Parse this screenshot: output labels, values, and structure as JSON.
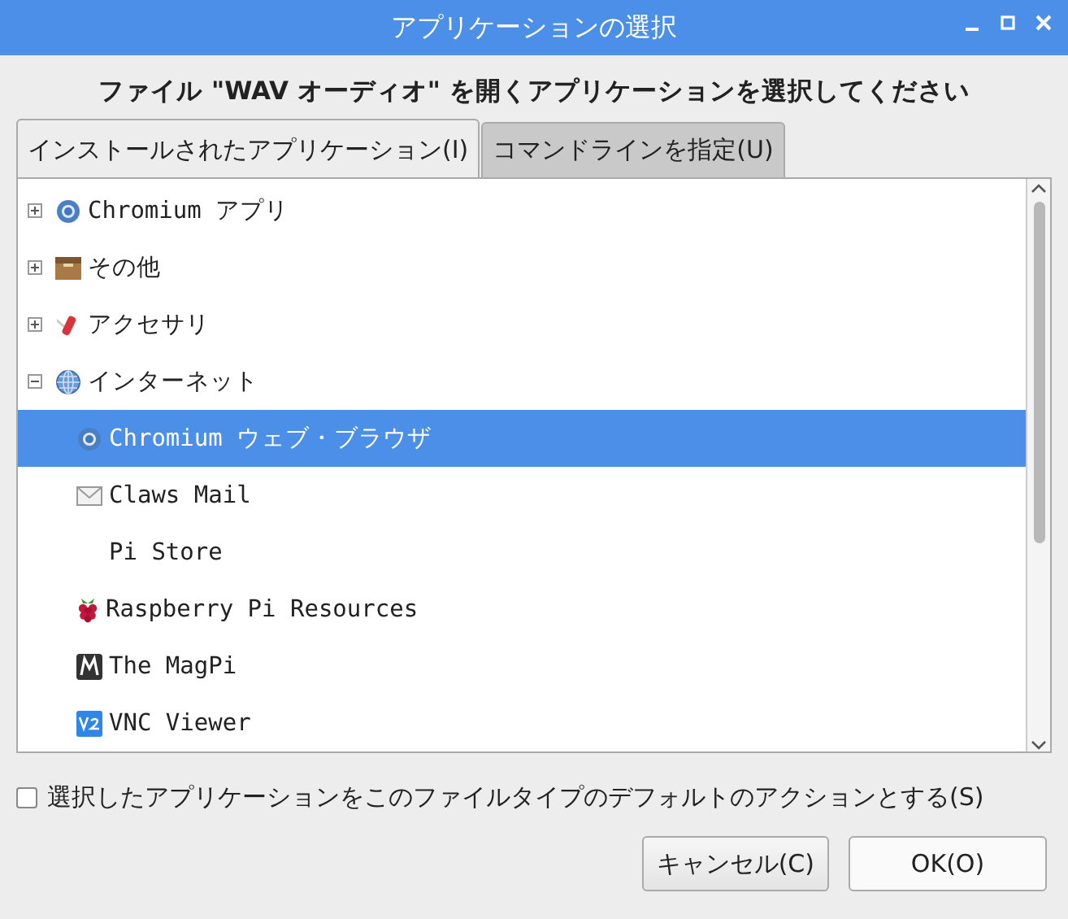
{
  "window": {
    "title": "アプリケーションの選択"
  },
  "heading": "ファイル \"WAV オーディオ\" を開くアプリケーションを選択してください",
  "tabs": [
    {
      "label": "インストールされたアプリケーション(I)",
      "selected": true
    },
    {
      "label": "コマンドラインを指定(U)",
      "selected": false
    }
  ],
  "tree": [
    {
      "label": "Chromium アプリ",
      "expanded": false,
      "selected": false
    },
    {
      "label": "その他",
      "expanded": false,
      "selected": false
    },
    {
      "label": "アクセサリ",
      "expanded": false,
      "selected": false
    },
    {
      "label": "インターネット",
      "expanded": true,
      "selected": false,
      "children": [
        {
          "label": "Chromium ウェブ・ブラウザ",
          "selected": true
        },
        {
          "label": "Claws Mail",
          "selected": false
        },
        {
          "label": "Pi Store",
          "selected": false
        },
        {
          "label": "Raspberry Pi Resources",
          "selected": false
        },
        {
          "label": "The MagPi",
          "selected": false
        },
        {
          "label": "VNC Viewer",
          "selected": false
        }
      ]
    }
  ],
  "default_checkbox": {
    "label": "選択したアプリケーションをこのファイルタイプのデフォルトのアクションとする(S)",
    "checked": false
  },
  "buttons": [
    {
      "label": "キャンセル(C)",
      "kind": "cancel"
    },
    {
      "label": "OK(O)",
      "kind": "ok"
    }
  ]
}
